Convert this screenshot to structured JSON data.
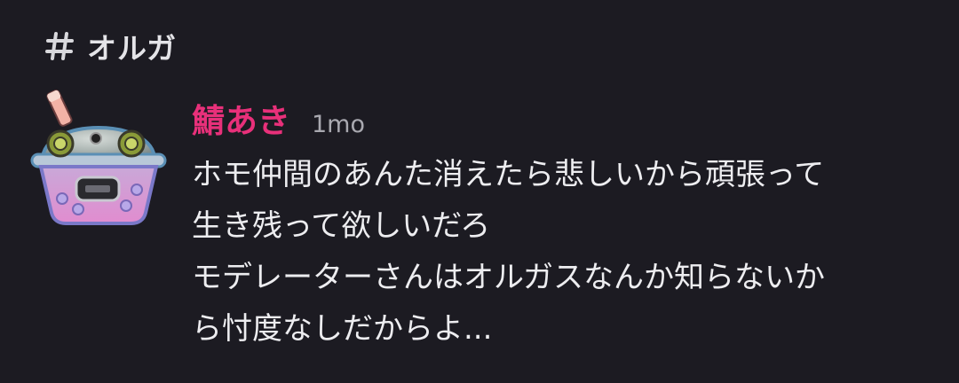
{
  "channel": {
    "icon": "hash-icon",
    "name": "オルガ"
  },
  "message": {
    "avatar_icon": "bubble-tea-robot-avatar",
    "author": "鯖あき",
    "author_color": "#e8307a",
    "timestamp": "1mo",
    "lines": [
      "ホモ仲間のあんた消えたら悲しいから頑張って",
      "生き残って欲しいだろ",
      "モデレーターさんはオルガスなんか知らないか",
      "ら忖度なしだからよ..."
    ]
  }
}
